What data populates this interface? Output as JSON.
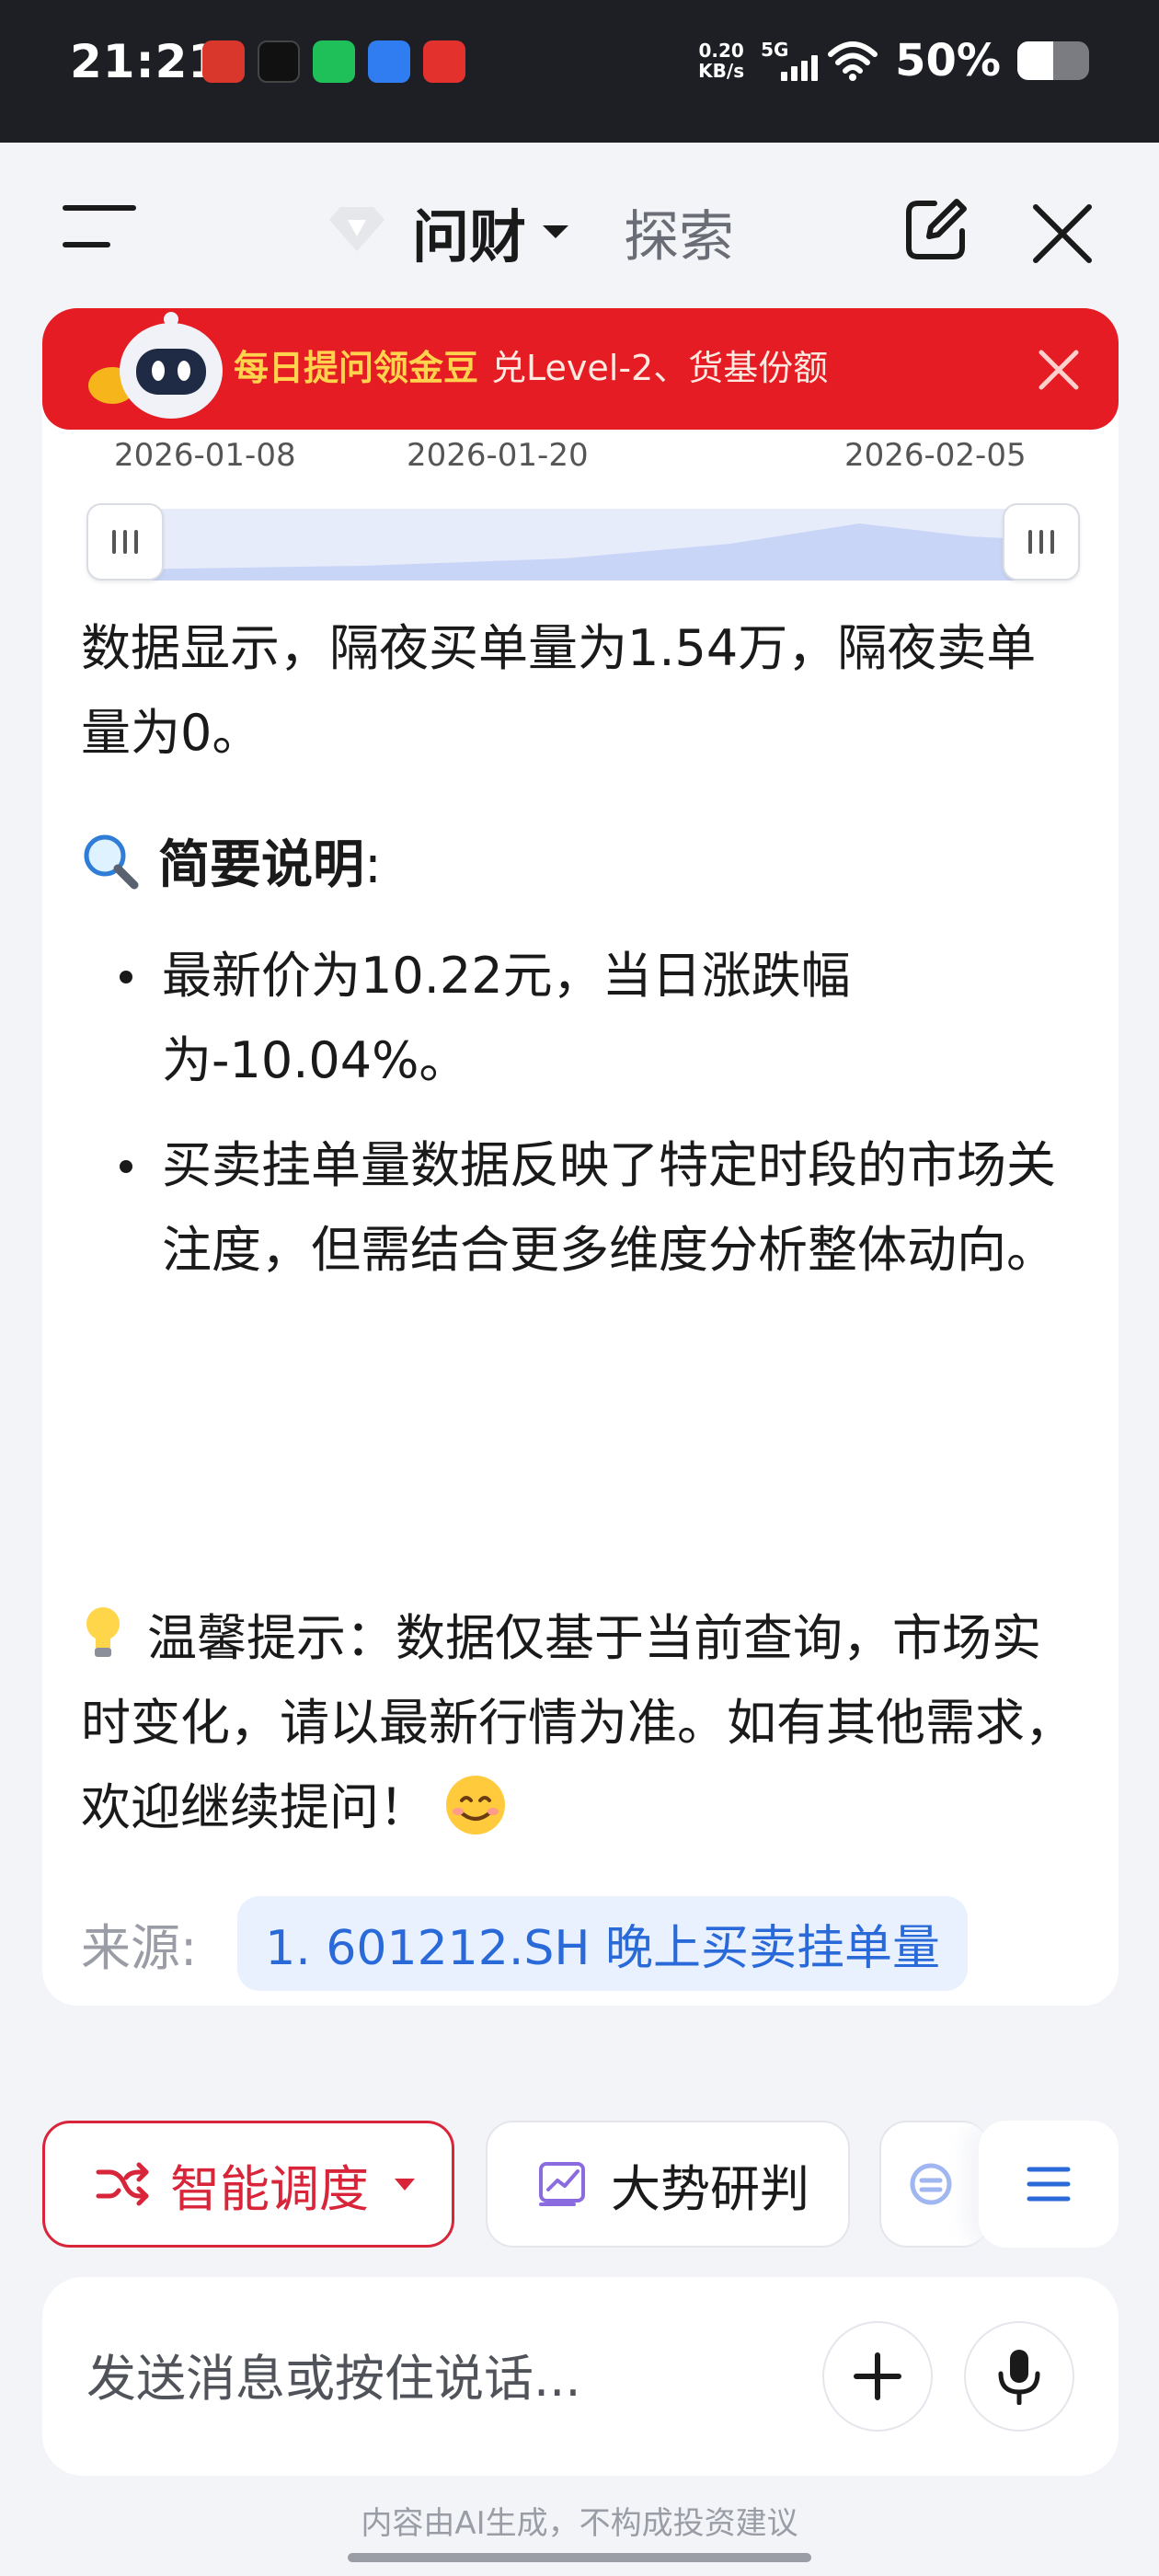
{
  "status_bar": {
    "time": "21:21",
    "net_speed_value": "0.20",
    "net_speed_unit": "KB/s",
    "network_type": "5G",
    "battery_percent": "50%",
    "battery_level": 0.5,
    "notification_icons": [
      "app-red-icon",
      "app-tiktok-icon",
      "wechat-icon",
      "app-blue-icon",
      "app-redpacket-icon"
    ]
  },
  "header": {
    "title": "问财",
    "explore": "探索"
  },
  "banner": {
    "bold_text": "每日提问领金豆",
    "sub_text": "兑Level-2、货基份额"
  },
  "timeline": {
    "dates": [
      "2026-01-08",
      "2026-01-20",
      "2026-02-05"
    ]
  },
  "content": {
    "paragraph1": "数据显示，隔夜买单量为1.54万，隔夜卖单量为0。",
    "summary_heading": "简要说明",
    "summary_colon": ":",
    "bullets": [
      "最新价为10.22元，当日涨跌幅为-10.04%。",
      "买卖挂单量数据反映了特定时段的市场关注度，但需结合更多维度分析整体动向。"
    ],
    "tip_text": "温馨提示：数据仅基于当前查询，市场实时变化，请以最新行情为准。如有其他需求，欢迎继续提问！",
    "source_label": "来源:",
    "source_chip": "1. 601212.SH 晚上买卖挂单量"
  },
  "pills": [
    {
      "label": "智能调度",
      "icon": "shuffle-icon"
    },
    {
      "label": "大势研判",
      "icon": "trend-chart-icon"
    }
  ],
  "input": {
    "placeholder": "发送消息或按住说话..."
  },
  "footer": {
    "disclaimer": "内容由AI生成，不构成投资建议"
  },
  "colors": {
    "brand_red": "#e51c24",
    "link_blue": "#2a6ad8",
    "chip_bg": "#e9f1ff"
  }
}
